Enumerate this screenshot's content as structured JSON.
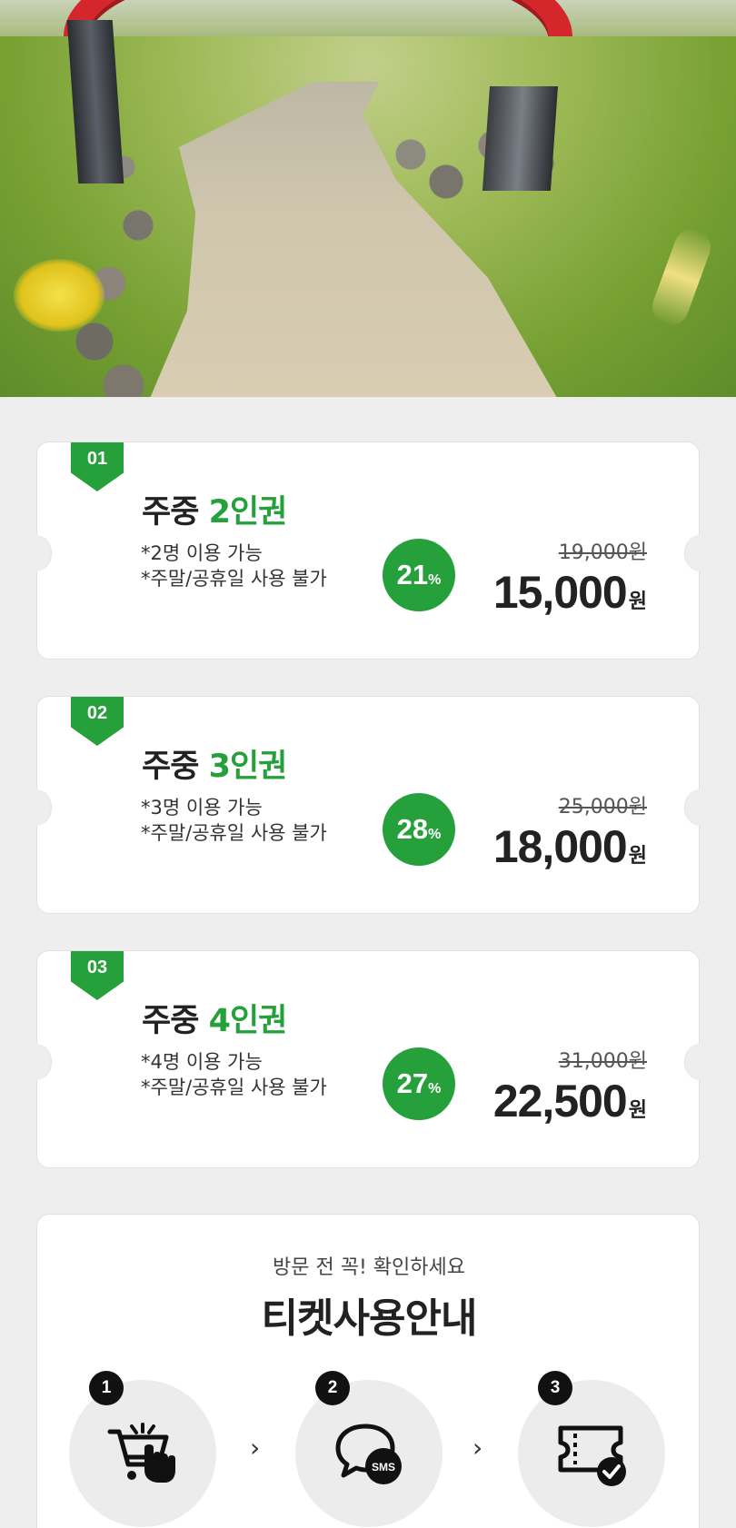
{
  "hero": {
    "image": "farm-path-with-red-arch"
  },
  "tickets": [
    {
      "badge": "01",
      "title_prefix": "주중 ",
      "title_accent": "2인권",
      "desc1": "*2명 이용 가능",
      "desc2": "*주말/공휴일 사용 불가",
      "discount_value": "21",
      "discount_unit": "%",
      "original_price": "19,000원",
      "price_value": "15,000",
      "price_unit": "원"
    },
    {
      "badge": "02",
      "title_prefix": "주중 ",
      "title_accent": "3인권",
      "desc1": "*3명 이용 가능",
      "desc2": "*주말/공휴일 사용 불가",
      "discount_value": "28",
      "discount_unit": "%",
      "original_price": "25,000원",
      "price_value": "18,000",
      "price_unit": "원"
    },
    {
      "badge": "03",
      "title_prefix": "주중 ",
      "title_accent": "4인권",
      "desc1": "*4명 이용 가능",
      "desc2": "*주말/공휴일 사용 불가",
      "discount_value": "27",
      "discount_unit": "%",
      "original_price": "31,000원",
      "price_value": "22,500",
      "price_unit": "원"
    }
  ],
  "guide": {
    "subtitle": "방문 전 꼭! 확인하세요",
    "title": "티켓사용안내",
    "steps": [
      {
        "number": "1",
        "icon": "cart-click-icon"
      },
      {
        "number": "2",
        "icon": "sms-chat-icon"
      },
      {
        "number": "3",
        "icon": "ticket-check-icon"
      }
    ],
    "arrow": "›",
    "sms_label": "SMS"
  },
  "colors": {
    "accent": "#26a03a",
    "background": "#eeeeee",
    "text": "#222222"
  }
}
